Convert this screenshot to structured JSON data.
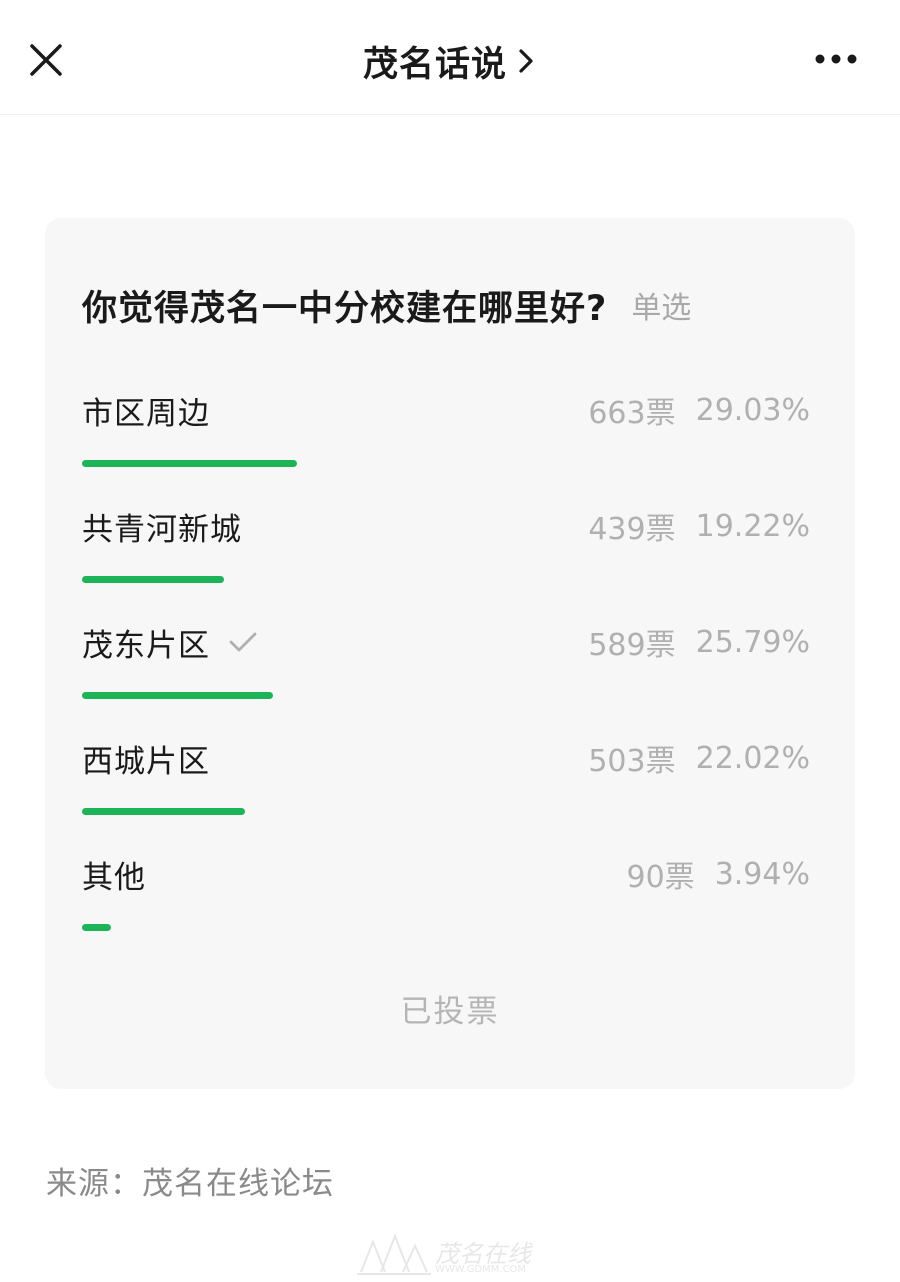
{
  "nav": {
    "title": "茂名话说",
    "close_icon": "close-icon",
    "chevron_icon": "chevron-right-icon",
    "more_icon": "more-icon"
  },
  "poll": {
    "question": "你觉得茂名一中分校建在哪里好?",
    "type": "单选",
    "options": [
      {
        "label": "市区周边",
        "votes": "663票",
        "percent": "29.03%",
        "fraction": 0.2903,
        "selected": false
      },
      {
        "label": "共青河新城",
        "votes": "439票",
        "percent": "19.22%",
        "fraction": 0.1922,
        "selected": false
      },
      {
        "label": "茂东片区",
        "votes": "589票",
        "percent": "25.79%",
        "fraction": 0.2579,
        "selected": true
      },
      {
        "label": "西城片区",
        "votes": "503票",
        "percent": "22.02%",
        "fraction": 0.2202,
        "selected": false
      },
      {
        "label": "其他",
        "votes": "90票",
        "percent": "3.94%",
        "fraction": 0.0394,
        "selected": false
      }
    ],
    "status": "已投票"
  },
  "source": "来源：茂名在线论坛",
  "watermark": {
    "title": "茂名在线",
    "url": "WWW.GDMM.COM"
  },
  "colors": {
    "bar": "#1db457",
    "muted": "#b0b0b0",
    "card": "#f7f7f7"
  }
}
